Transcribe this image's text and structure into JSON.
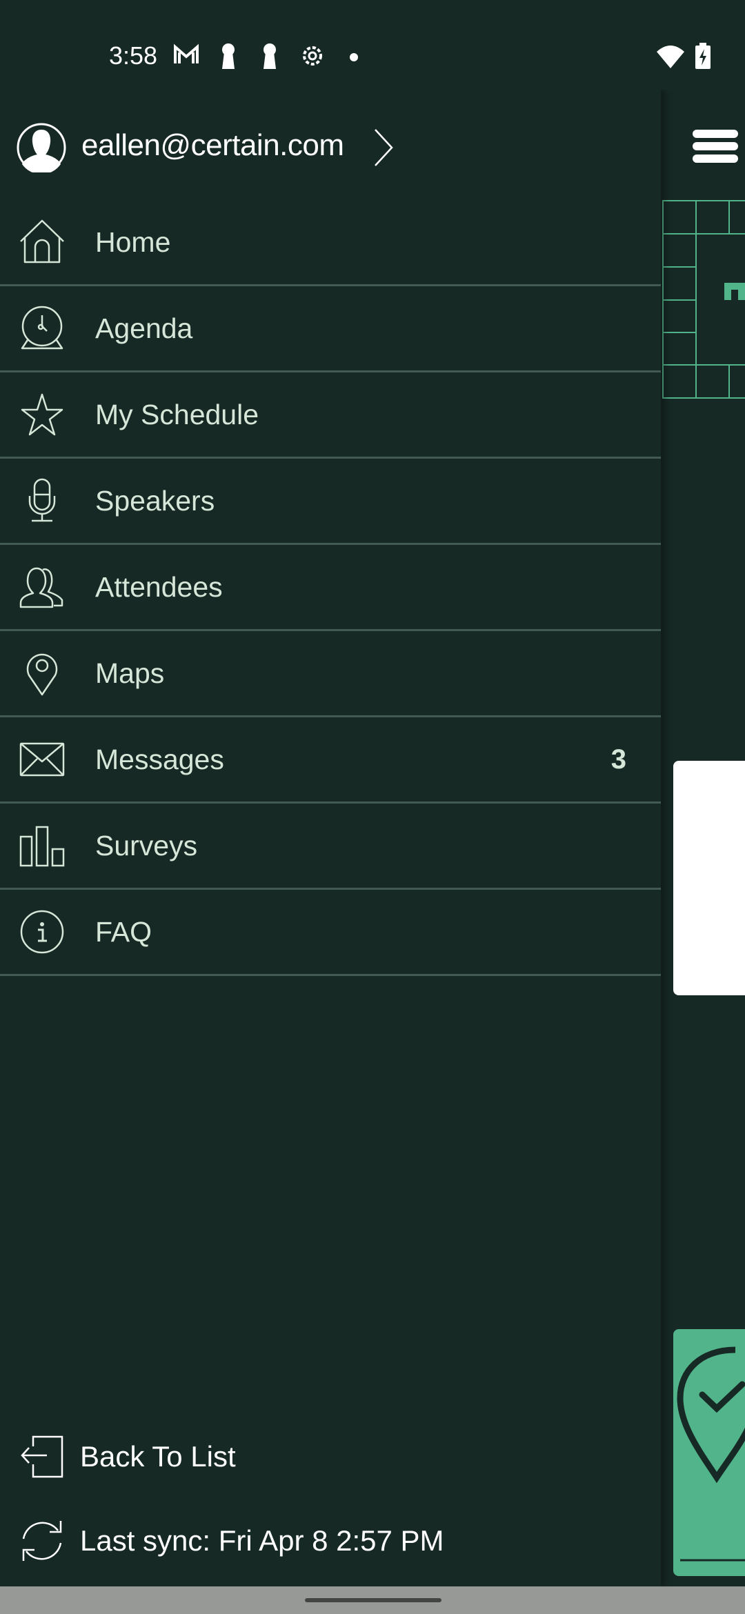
{
  "status_bar": {
    "time": "3:58",
    "icons": [
      "gmail-icon",
      "keyhole-icon",
      "keyhole-icon",
      "settings-icon",
      "dot-icon"
    ],
    "right_icons": [
      "wifi-icon",
      "battery-charging-icon"
    ]
  },
  "drawer": {
    "profile": {
      "email": "eallen@certain.com",
      "avatar_icon": "user-avatar-icon",
      "chevron_icon": "chevron-right-icon"
    },
    "items": [
      {
        "label": "Home",
        "icon": "home-icon"
      },
      {
        "label": "Agenda",
        "icon": "clock-icon"
      },
      {
        "label": "My Schedule",
        "icon": "star-icon"
      },
      {
        "label": "Speakers",
        "icon": "microphone-icon"
      },
      {
        "label": "Attendees",
        "icon": "people-icon"
      },
      {
        "label": "Maps",
        "icon": "map-pin-icon"
      },
      {
        "label": "Messages",
        "icon": "envelope-icon",
        "badge": "3"
      },
      {
        "label": "Surveys",
        "icon": "bar-chart-icon"
      },
      {
        "label": "FAQ",
        "icon": "info-icon"
      }
    ],
    "footer": {
      "back_label": "Back To List",
      "sync_label": "Last sync: Fri Apr 8 2:57 PM"
    }
  },
  "colors": {
    "background": "#172925",
    "text": "#d6e6d8",
    "divider": "#435a54",
    "accent": "#52b48b"
  }
}
